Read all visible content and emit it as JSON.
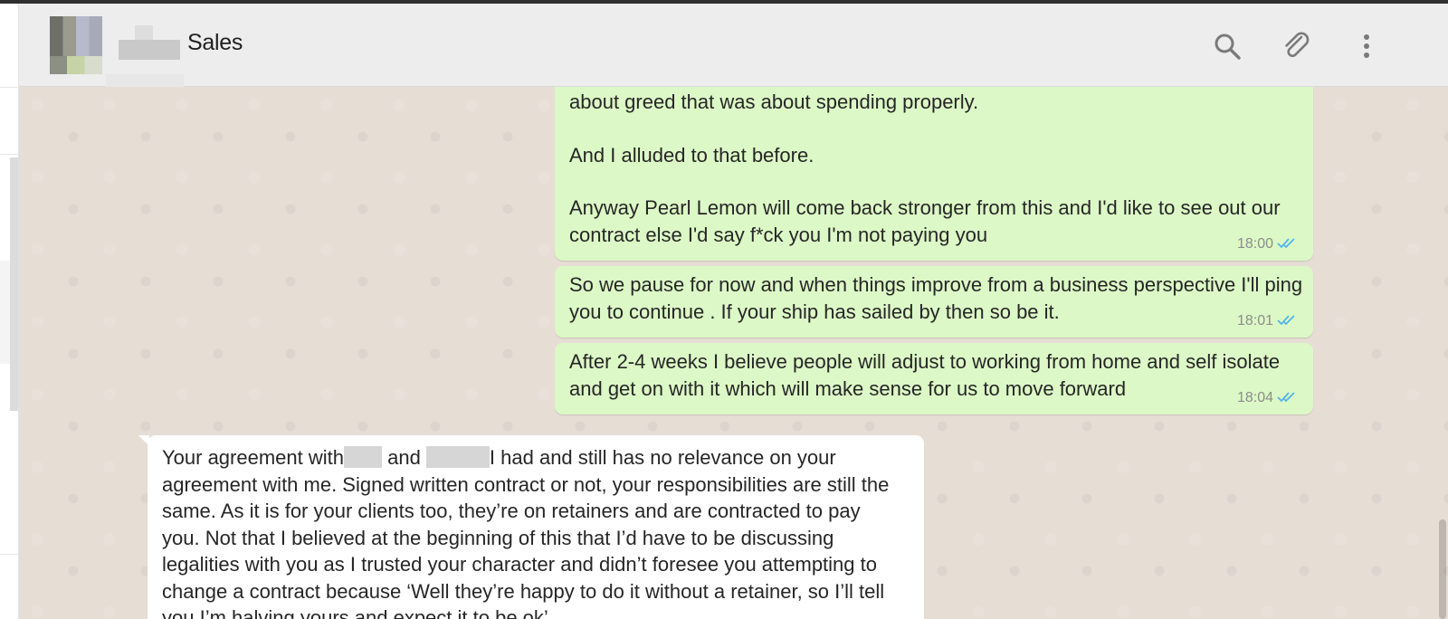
{
  "header": {
    "title": "Sales",
    "icons": [
      "search-icon",
      "attach-icon",
      "menu-icon"
    ]
  },
  "messages": [
    {
      "direction": "outgoing",
      "lines": [
        "about greed that was about spending properly.",
        "",
        "And I alluded to that before.",
        "",
        "Anyway Pearl Lemon will come back stronger from this and I'd like to see out our",
        "contract else I'd say f*ck you I'm not paying you"
      ],
      "time": "18:00",
      "status": "read"
    },
    {
      "direction": "outgoing",
      "lines": [
        "So we pause for now and when things improve from a business perspective I'll ping",
        "you to continue . If your ship has sailed by then so be it."
      ],
      "time": "18:01",
      "status": "read"
    },
    {
      "direction": "outgoing",
      "lines": [
        "After 2-4 weeks I believe people will adjust to working from home and self isolate",
        "and get on with it which will make sense for us to move forward"
      ],
      "time": "18:04",
      "status": "read"
    },
    {
      "direction": "incoming",
      "first_line": {
        "part1": "Your agreement with",
        "part2": " and ",
        "part3": "I had and still has no relevance on your"
      },
      "lines": [
        "agreement with me. Signed written contract or not, your responsibilities are still the",
        "same. As it is for your clients too, they’re on retainers and are contracted to pay",
        "you. Not that I believed at the beginning of this that I’d have to be discussing",
        "legalities with you as I trusted your character and didn’t foresee you attempting to",
        "change a contract because ‘Well they’re happy to do it without a retainer, so I’ll tell",
        "you I’m halving yours and expect it to be ok’"
      ]
    }
  ],
  "colors": {
    "outgoing_bubble": "#dcf8c6",
    "incoming_bubble": "#ffffff",
    "chat_background": "#e6ded5",
    "read_ticks": "#4fb6ec"
  }
}
